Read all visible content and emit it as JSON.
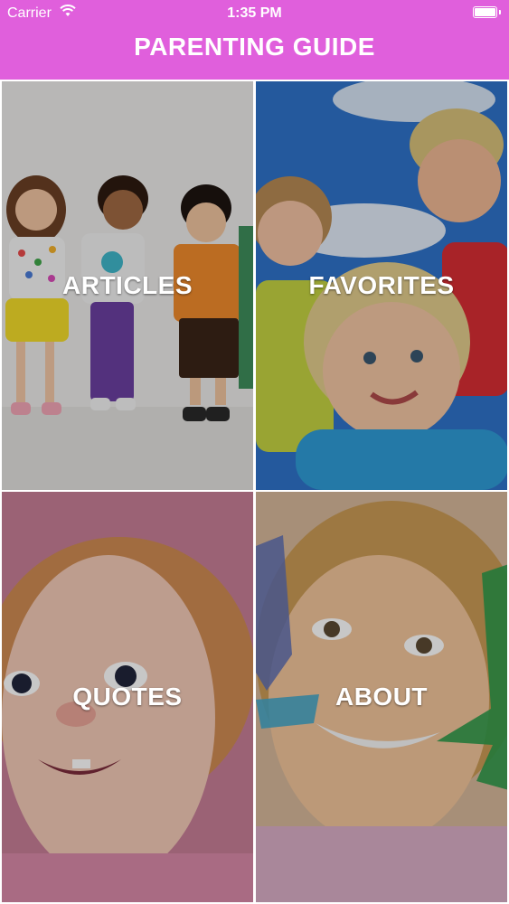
{
  "status_bar": {
    "carrier": "Carrier",
    "time": "1:35 PM"
  },
  "header": {
    "title": "PARENTING GUIDE",
    "background": "#e05fdc"
  },
  "tiles": [
    {
      "label": "ARTICLES"
    },
    {
      "label": "FAVORITES"
    },
    {
      "label": "QUOTES"
    },
    {
      "label": "ABOUT"
    }
  ]
}
